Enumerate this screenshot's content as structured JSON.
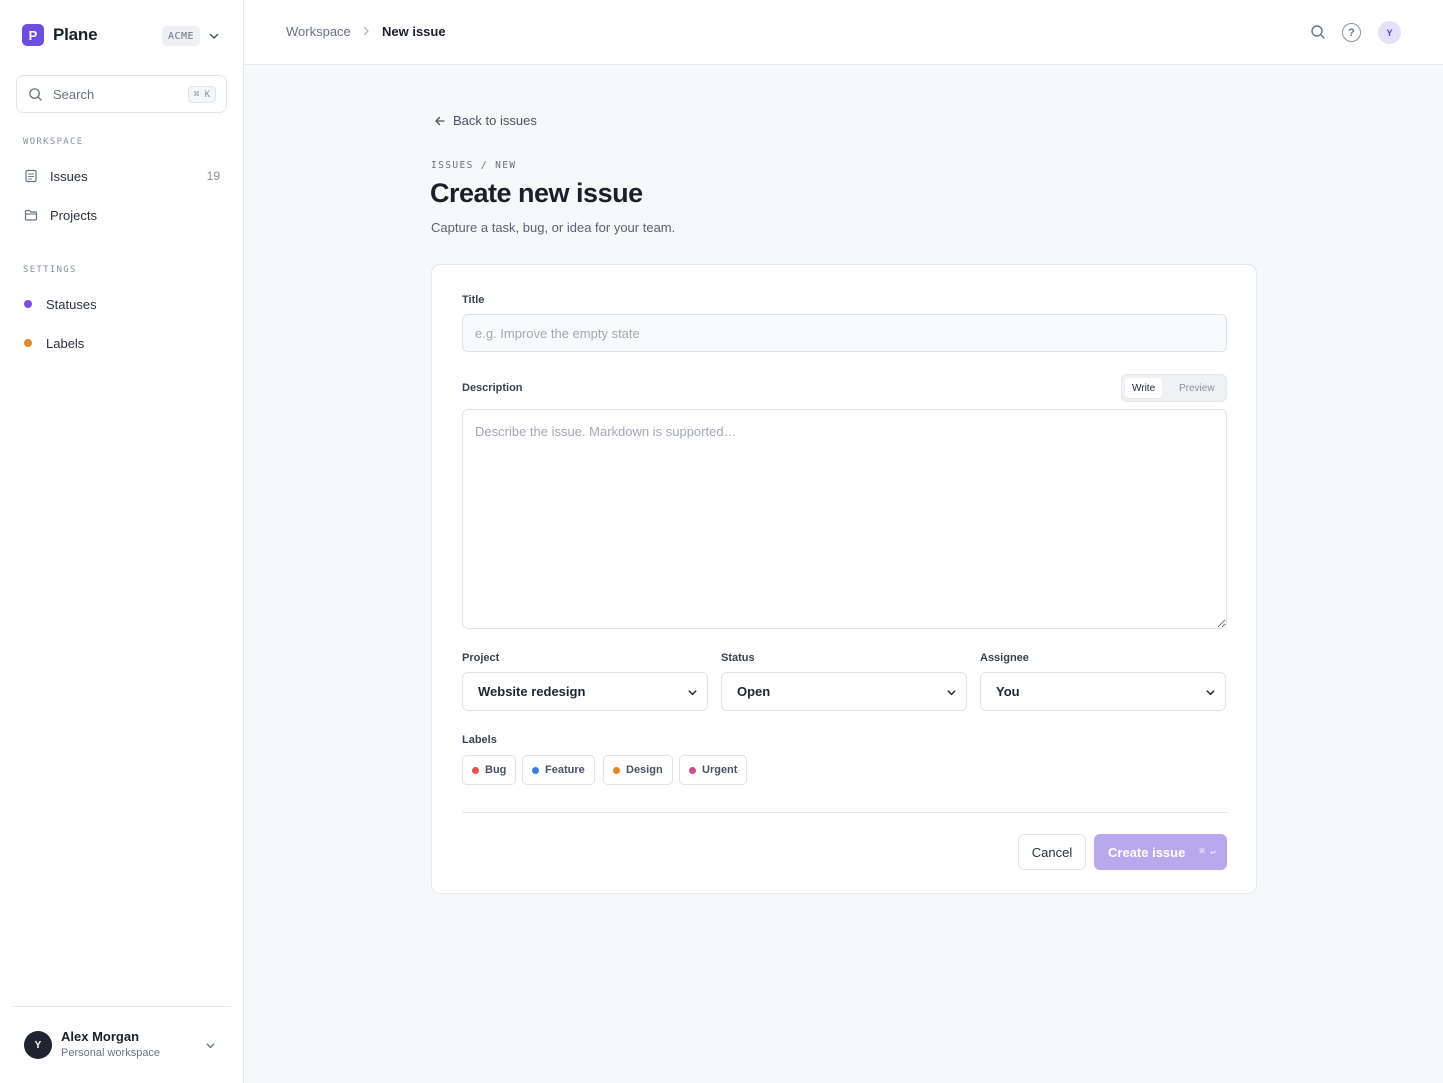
{
  "brand": {
    "logo_letter": "P",
    "name": "Plane",
    "workspace_badge": "ACME"
  },
  "search": {
    "label": "Search",
    "shortcut": "⌘ K"
  },
  "sidebar": {
    "workspace_heading": "WORKSPACE",
    "workspace_items": [
      {
        "label": "Issues",
        "count": "19",
        "icon": "document-icon"
      },
      {
        "label": "Projects",
        "icon": "folder-icon"
      }
    ],
    "settings_heading": "SETTINGS",
    "settings_items": [
      {
        "label": "Statuses",
        "color": "#7c4ddb"
      },
      {
        "label": "Labels",
        "color": "#e08a2b"
      }
    ]
  },
  "user": {
    "initial": "Y",
    "name": "Alex Morgan",
    "subtitle": "Personal workspace"
  },
  "topbar": {
    "breadcrumb_parent": "Workspace",
    "breadcrumb_current": "New issue",
    "help_glyph": "?",
    "avatar_initial": "Y"
  },
  "main": {
    "back_label": "Back to issues",
    "overline": "ISSUES / NEW",
    "title": "Create new issue",
    "subtitle": "Capture a task, bug, or idea for your team."
  },
  "form": {
    "title_label": "Title",
    "title_placeholder": "e.g. Improve the empty state",
    "title_value": "",
    "description_label": "Description",
    "description_placeholder": "Describe the issue. Markdown is supported…",
    "description_value": "",
    "tab_write": "Write",
    "tab_preview": "Preview",
    "project_label": "Project",
    "project_value": "Website redesign",
    "status_label": "Status",
    "status_value": "Open",
    "assignee_label": "Assignee",
    "assignee_value": "You",
    "labels_label": "Labels",
    "labels": [
      {
        "name": "Bug",
        "color": "#e0524d"
      },
      {
        "name": "Feature",
        "color": "#3b82d6"
      },
      {
        "name": "Design",
        "color": "#e08a2b"
      },
      {
        "name": "Urgent",
        "color": "#d14a8a"
      }
    ],
    "cancel_label": "Cancel",
    "create_label": "Create issue",
    "create_shortcut": "⌘ ↵"
  },
  "colors": {
    "accent": "#6d4fe0",
    "accent_disabled": "#b8a9ee"
  }
}
